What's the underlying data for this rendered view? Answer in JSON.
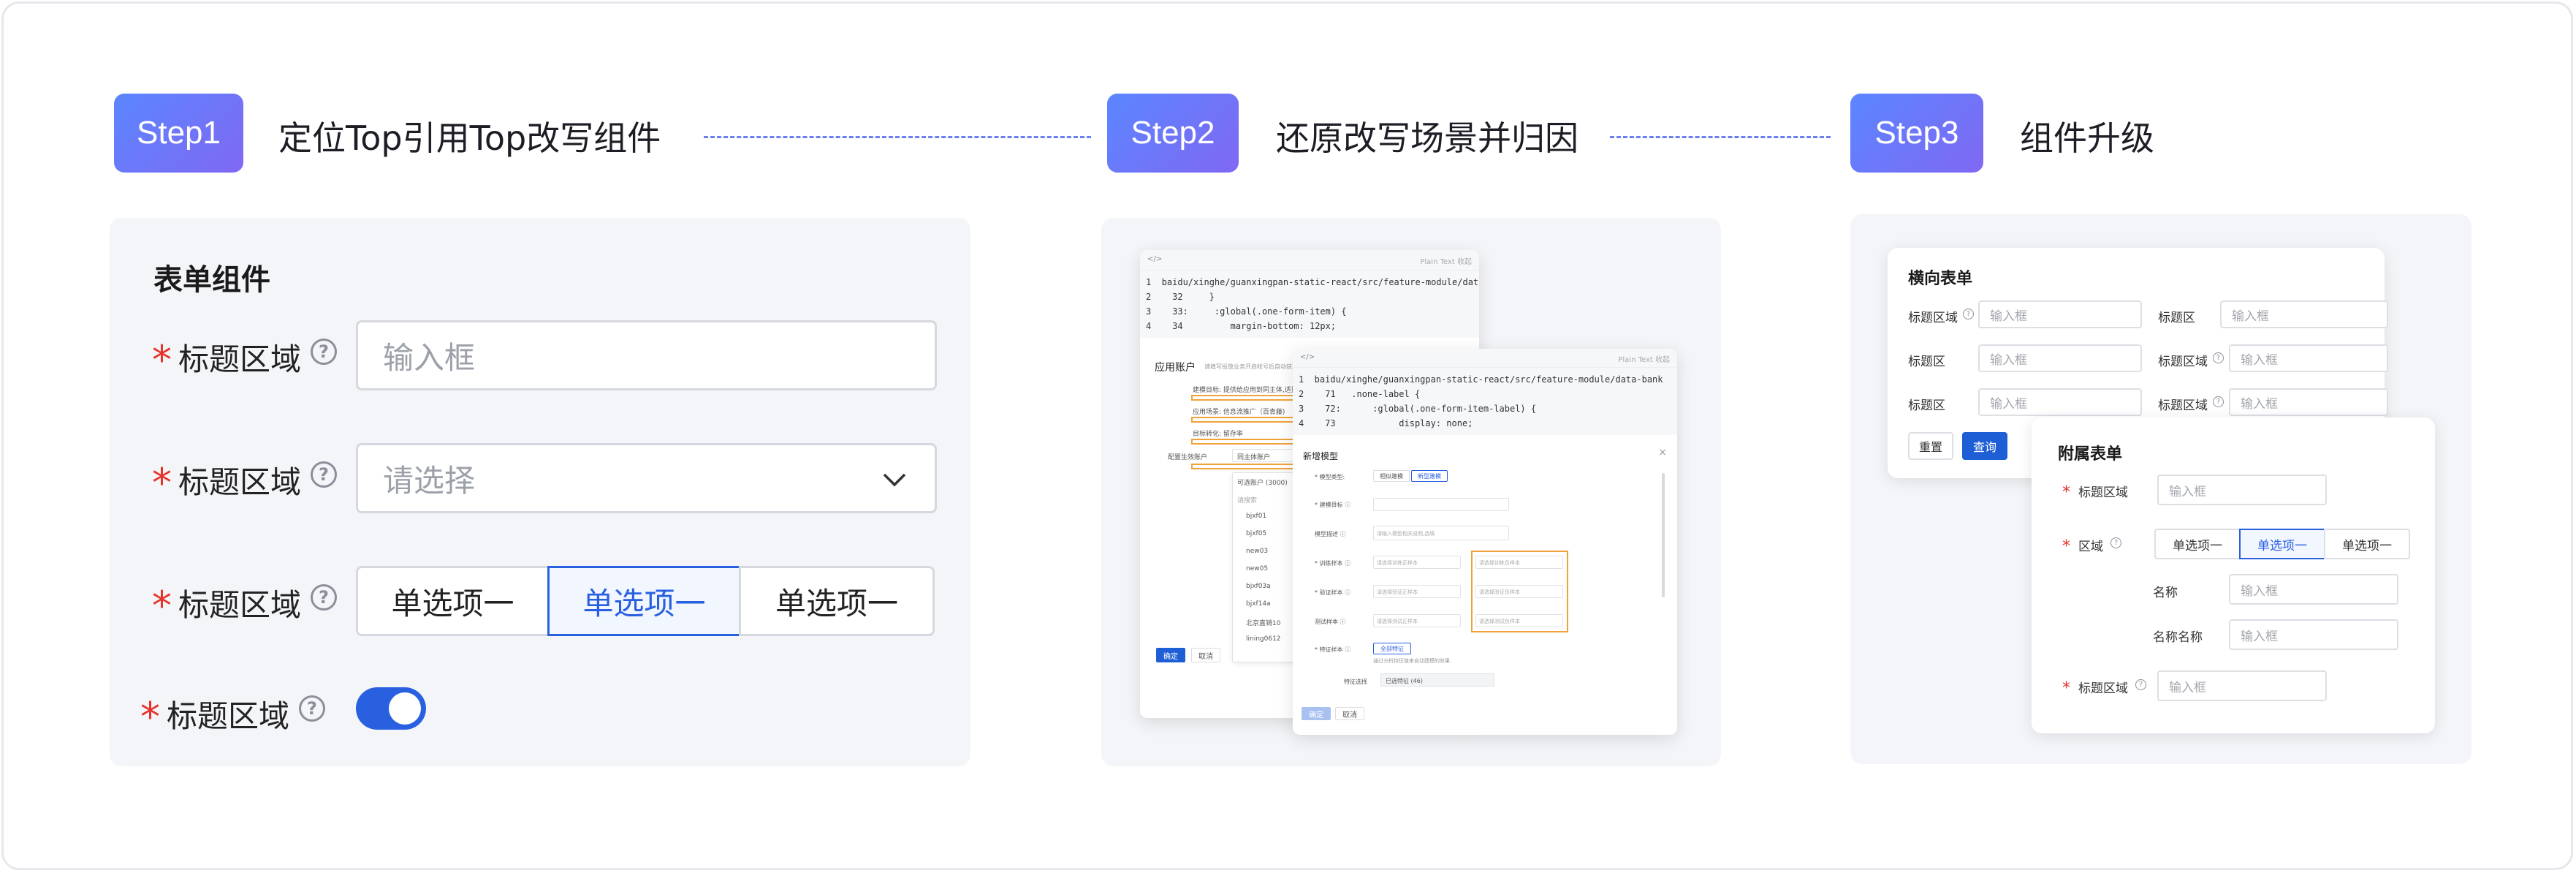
{
  "steps": [
    {
      "badge": "Step1",
      "title": "定位Top引用Top改写组件"
    },
    {
      "badge": "Step2",
      "title": "还原改写场景并归因"
    },
    {
      "badge": "Step3",
      "title": "组件升级"
    }
  ],
  "form_panel": {
    "title": "表单组件",
    "field_label": "标题区域",
    "help": "?",
    "input_placeholder": "输入框",
    "select_placeholder": "请选择",
    "radio_options": [
      "单选项一",
      "单选项一",
      "单选项一"
    ],
    "radio_selected_index": 1,
    "switch_on": true
  },
  "code_panel": {
    "window1": {
      "toolbar_right": "Plain Text   收起",
      "lines": [
        "1  baidu/xinghe/guanxingpan-static-react/src/feature-module/data-bank",
        "2    32     }",
        "3    33:     :global(.one-form-item) {",
        "4    34         margin-bottom: 12px;"
      ],
      "section_title": "应用账户",
      "section_hint": "请填写投放业务开启帐号后自动获取(多个逗号隔开)",
      "rows": [
        "建模目标: 提供给应用到同主体,适量",
        "应用场景: 信息流推广（百青藤)",
        "目标转化: 留存率"
      ],
      "config_label": "配置生效账户",
      "config_value": "同主体账户",
      "dropdown_items": [
        "可选账户 (3000)",
        "请搜索",
        "bjxf01",
        "bjxf05",
        "new03",
        "new05",
        "bjxf03a",
        "bjxf14a",
        "北京直销10",
        "lining0612"
      ],
      "ok": "确定",
      "cancel": "取消"
    },
    "window2": {
      "toolbar_right": "Plain Text   收起",
      "lines": [
        "1  baidu/xinghe/guanxingpan-static-react/src/feature-module/data-bank",
        "2    71   .none-label {",
        "3    72:      :global(.one-form-item-label) {",
        "4    73            display: none;"
      ],
      "modal_title": "新增模型",
      "close": "×",
      "fields": [
        {
          "label": "* 模型类型:",
          "value": ""
        },
        {
          "label": "* 建模目标 ⓘ",
          "value": ""
        },
        {
          "label": "模型描述 ⓘ",
          "value": "请输入模型相关说明,选填"
        },
        {
          "label": "* 训练样本 ⓘ",
          "value": "请选择训练正样本"
        },
        {
          "label": "* 验证样本 ⓘ",
          "value": "请选择验证正样本"
        },
        {
          "label": "测试样本 ⓘ",
          "value": "请选择测试正样本"
        },
        {
          "label": "* 特征样本 ⓘ",
          "value": ""
        },
        {
          "label": "特征选择",
          "value": "已选特征 (46)"
        }
      ],
      "right_values": [
        "请选择训练负样本",
        "请选择验证负样本",
        "请选择测试负样本"
      ],
      "type_options": [
        "相似建模",
        "新型建模"
      ],
      "feature_btn": "全部特征",
      "feature_hint": "通过分析特征值来自动建模的效果",
      "ok": "确定",
      "cancel": "取消"
    }
  },
  "upgrade_panel": {
    "horizontal_title": "横向表单",
    "h_rows": [
      [
        {
          "label": "标题区域",
          "help": true,
          "placeholder": "输入框"
        },
        {
          "label": "标题区",
          "help": false,
          "placeholder": "输入框"
        }
      ],
      [
        {
          "label": "标题区",
          "help": false,
          "placeholder": "输入框"
        },
        {
          "label": "标题区域",
          "help": true,
          "placeholder": "输入框"
        }
      ],
      [
        {
          "label": "标题区",
          "help": false,
          "placeholder": "输入框"
        },
        {
          "label": "标题区域",
          "help": true,
          "placeholder": "输入框"
        }
      ]
    ],
    "reset": "重置",
    "query": "查询",
    "attached_title": "附属表单",
    "a_label1": "标题区域",
    "a_placeholder1": "输入框",
    "a_label2": "区域",
    "a_options": [
      "单选项一",
      "单选项一",
      "单选项一"
    ],
    "a_selected_index": 1,
    "name_label": "名称",
    "name_placeholder": "输入框",
    "name2_label": "名称名称",
    "name2_placeholder": "输入框",
    "a_label3": "标题区域",
    "a_placeholder3": "输入框"
  },
  "colors": {
    "accent": "#2960e0",
    "required": "#e7332b",
    "highlight": "#f0a23a",
    "step_gradient_start": "#5b86ff",
    "step_gradient_end": "#8068f3"
  }
}
